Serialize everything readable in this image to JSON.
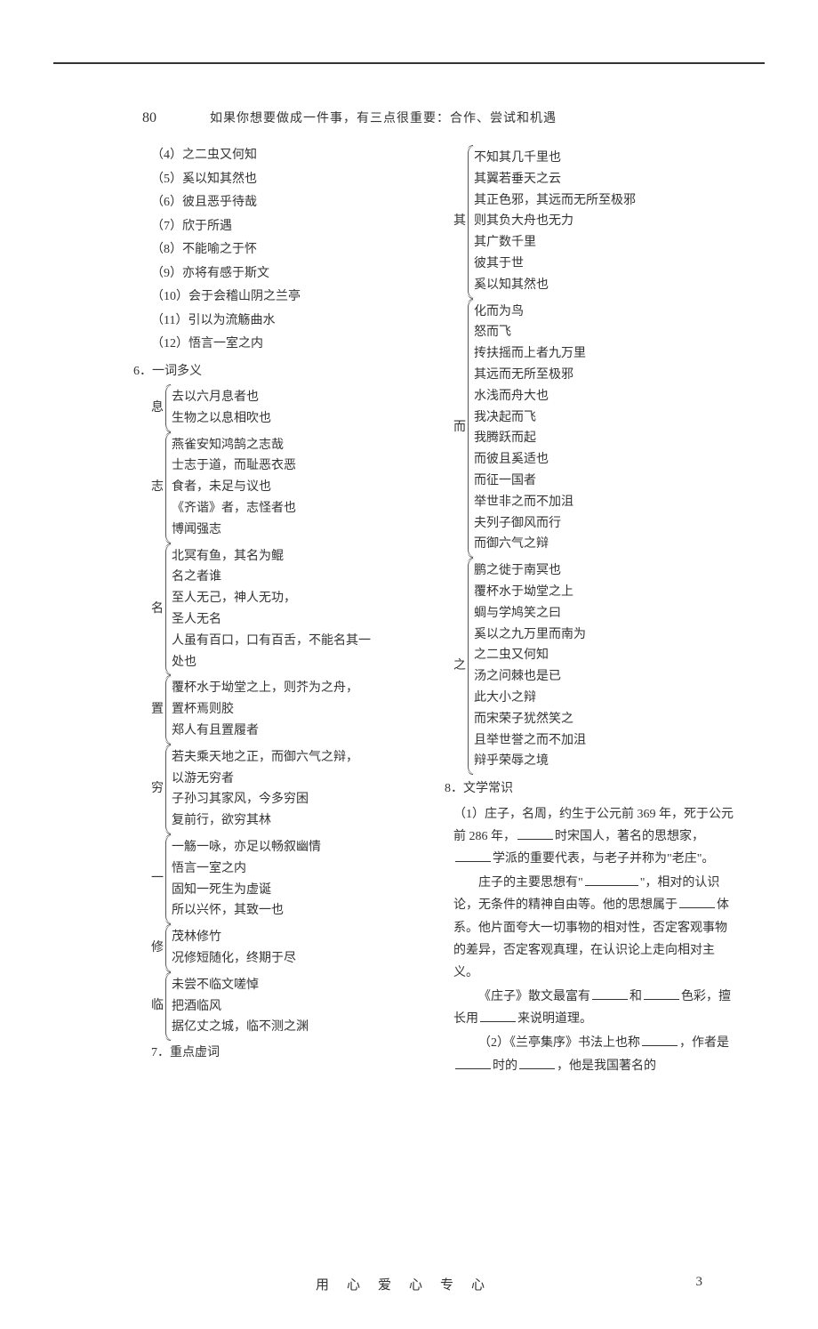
{
  "page_number_top": "80",
  "header_quote": "如果你想要做成一件事，有三点很重要：合作、尝试和机遇",
  "left": {
    "items4to12": [
      "（4）之二虫又何知",
      "（5）奚以知其然也",
      "（6）彼且恶乎待哉",
      "（7）欣于所遇",
      "（8）不能喻之于怀",
      "（9）亦将有感于斯文",
      "（10）会于会稽山阴之兰亭",
      "（11）引以为流觞曲水",
      "（12）悟言一室之内"
    ],
    "section6": "6．一词多义",
    "grp_xi_label": "息",
    "grp_xi": [
      "去以六月息者也",
      "生物之以息相吹也"
    ],
    "grp_zhi_label": "志",
    "grp_zhi": [
      "燕雀安知鸿鹄之志哉",
      "士志于道，而耻恶衣恶",
      "食者，未足与议也",
      "《齐谐》者，志怪者也",
      "博闻强志"
    ],
    "grp_ming_label": "名",
    "grp_ming": [
      "北冥有鱼，其名为鲲",
      "名之者谁",
      "至人无己，神人无功，",
      "圣人无名",
      "人虽有百口，口有百舌，不能名其一",
      "处也"
    ],
    "grp_zhi2_label": "置",
    "grp_zhi2": [
      "覆杯水于坳堂之上，则芥为之舟，",
      "置杯焉则胶",
      "郑人有且置履者"
    ],
    "grp_qiong_label": "穷",
    "grp_qiong": [
      "若夫乘天地之正，而御六气之辩，",
      "以游无穷者",
      "子孙习其家风，今多穷困",
      "复前行，欲穷其林"
    ],
    "grp_yi_label": "一",
    "grp_yi": [
      "一觞一咏，亦足以畅叙幽情",
      "悟言一室之内",
      "固知一死生为虚诞",
      "所以兴怀，其致一也"
    ],
    "grp_xiu_label": "修",
    "grp_xiu": [
      "茂林修竹",
      "况修短随化，终期于尽"
    ],
    "grp_lin_label": "临",
    "grp_lin": [
      "未尝不临文嗟悼",
      "把酒临风",
      "据亿丈之城，临不测之渊"
    ],
    "section7": "7．重点虚词"
  },
  "right": {
    "grp_qi_label": "其",
    "grp_qi": [
      "不知其几千里也",
      "其翼若垂天之云",
      "其正色邪，其远而无所至极邪",
      "则其负大舟也无力",
      "其广数千里",
      "彼其于世",
      "奚以知其然也"
    ],
    "grp_er_label": "而",
    "grp_er": [
      "化而为鸟",
      "怒而飞",
      "抟扶摇而上者九万里",
      "其远而无所至极邪",
      "水浅而舟大也",
      "我决起而飞",
      "我腾跃而起",
      "而彼且奚适也",
      "而征一国者",
      "举世非之而不加沮",
      "夫列子御风而行",
      "而御六气之辩"
    ],
    "grp_zhi3_label": "之",
    "grp_zhi3": [
      "鹏之徙于南冥也",
      "覆杯水于坳堂之上",
      "蜩与学鸠笑之曰",
      "奚以之九万里而南为",
      "之二虫又何知",
      "汤之问棘也是已",
      "此大小之辩",
      "而宋荣子犹然笑之",
      "且举世誉之而不加沮",
      "辩乎荣辱之境"
    ],
    "section8": "8．文学常识",
    "para1_pre": "（1）庄子，名周，约生于公元前 369 年，死于公元前 286 年，",
    "para1_mid1": "时宋国人，著名的思想家，",
    "para1_mid2": "学派的重要代表，与老子并称为\"老庄\"。",
    "para2_pre": "庄子的主要思想有\"",
    "para2_mid": "\"，相对的认识论，无条件的精神自由等。他的思想属于",
    "para2_end": "体系。他片面夸大一切事物的相对性，否定客观事物的差异，否定客观真理，在认识论上走向相对主义。",
    "para3_pre": "《庄子》散文最富有",
    "para3_mid1": "和",
    "para3_mid2": "色彩，擅长用",
    "para3_end": "来说明道理。",
    "para4_pre": "（2）《兰亭集序》书法上也称",
    "para4_mid1": "，作者是",
    "para4_mid2": "时的",
    "para4_end": "，他是我国著名的"
  },
  "footer_text": "用心爱心专心",
  "footer_page": "3"
}
